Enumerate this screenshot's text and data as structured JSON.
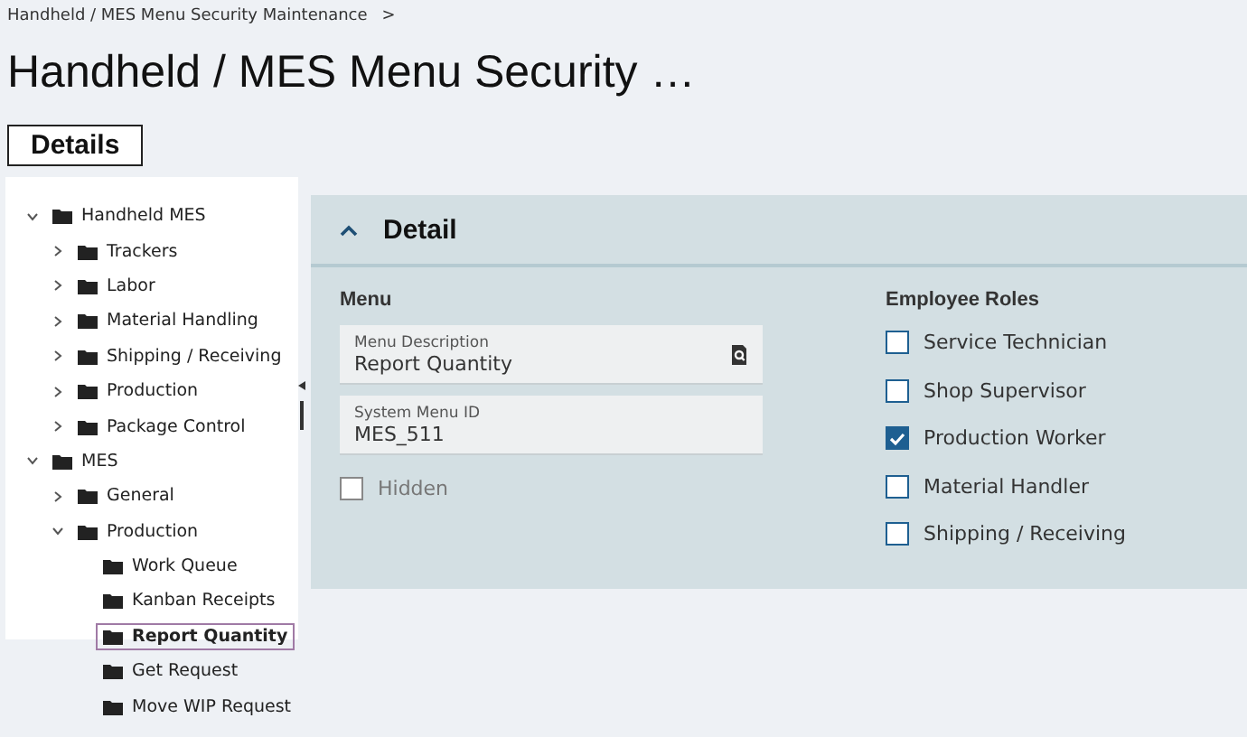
{
  "breadcrumb": {
    "label": "Handheld / MES Menu Security Maintenance",
    "separator": ">"
  },
  "title": "Handheld / MES Menu Security …",
  "tabs": [
    {
      "label": "Details",
      "selected": true
    }
  ],
  "tree": [
    {
      "label": "Handheld MES",
      "expanded": true,
      "children": [
        {
          "label": "Trackers",
          "expanded": false
        },
        {
          "label": "Labor",
          "expanded": false
        },
        {
          "label": "Material Handling",
          "expanded": false
        },
        {
          "label": "Shipping / Receiving",
          "expanded": false
        },
        {
          "label": "Production",
          "expanded": false
        },
        {
          "label": "Package Control",
          "expanded": false
        }
      ]
    },
    {
      "label": "MES",
      "expanded": true,
      "children": [
        {
          "label": "General",
          "expanded": false
        },
        {
          "label": "Production",
          "expanded": true,
          "children": [
            {
              "label": "Work Queue",
              "selected": false
            },
            {
              "label": "Kanban Receipts",
              "selected": false
            },
            {
              "label": "Report Quantity",
              "selected": true
            },
            {
              "label": "Get Request",
              "selected": false
            },
            {
              "label": "Move WIP Request",
              "selected": false
            }
          ]
        }
      ]
    }
  ],
  "detail": {
    "title": "Detail",
    "expanded": true,
    "menu": {
      "heading": "Menu",
      "fields": [
        {
          "label": "Menu Description",
          "value": "Report Quantity",
          "kind": "lookup"
        },
        {
          "label": "System Menu ID",
          "value": "MES_511",
          "kind": "text"
        }
      ],
      "hidden": {
        "label": "Hidden",
        "checked": false
      }
    },
    "roles": {
      "heading": "Employee Roles",
      "items": [
        {
          "label": "Service Technician",
          "checked": false
        },
        {
          "label": "Shop Supervisor",
          "checked": false
        },
        {
          "label": "Production Worker",
          "checked": true
        },
        {
          "label": "Material Handler",
          "checked": false
        },
        {
          "label": "Shipping / Receiving",
          "checked": false
        }
      ]
    }
  }
}
